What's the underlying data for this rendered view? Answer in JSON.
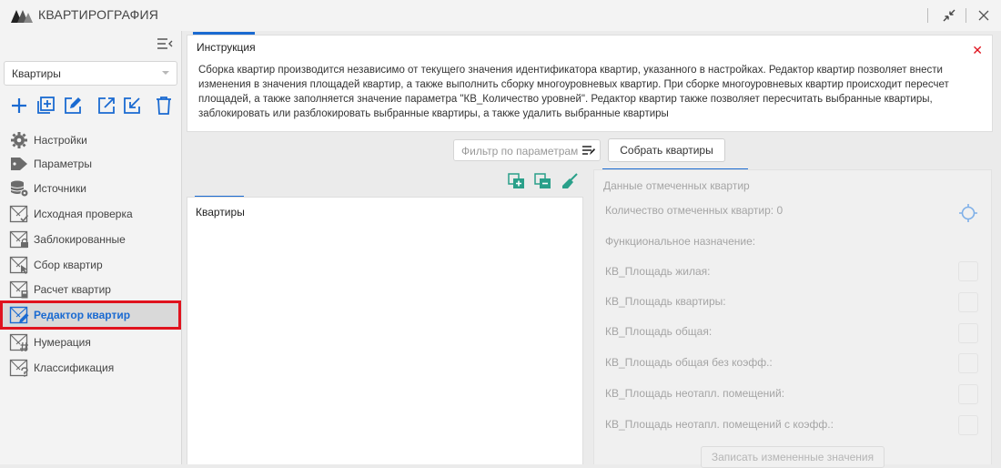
{
  "window": {
    "title": "КВАРТИРОГРАФИЯ",
    "restore_icon": "collapse-arrows-icon",
    "close_icon": "close-icon"
  },
  "sidebar": {
    "dropdown": {
      "value": "Квартиры"
    },
    "toolbar": [
      "add-icon",
      "add-box-icon",
      "edit-icon",
      "export-icon",
      "import-icon",
      "delete-icon"
    ],
    "items": [
      {
        "label": "Настройки",
        "icon": "gear-icon"
      },
      {
        "label": "Параметры",
        "icon": "tag-icon"
      },
      {
        "label": "Источники",
        "icon": "database-gear-icon"
      },
      {
        "label": "Исходная проверка",
        "icon": "check-plan-icon"
      },
      {
        "label": "Заблокированные",
        "icon": "lock-plan-icon"
      },
      {
        "label": "Сбор квартир",
        "icon": "cursor-plan-icon"
      },
      {
        "label": "Расчет квартир",
        "icon": "calc-plan-icon"
      },
      {
        "label": "Редактор квартир",
        "icon": "edit-plan-icon"
      },
      {
        "label": "Нумерация",
        "icon": "hash-plan-icon"
      },
      {
        "label": "Классификация",
        "icon": "question-plan-icon"
      }
    ],
    "active_index": 7
  },
  "instruction": {
    "title": "Инструкция",
    "text": "Сборка квартир производится независимо от текущего значения идентификатора квартир, указанного в настройках. Редактор квартир позволяет внести изменения в значения площадей квартир, а также выполнить сборку многоуровневых квартир. При сборке многоуровневых квартир происходит пересчет площадей, а также заполняется значение параметра \"КВ_Количество уровней\". Редактор квартир также позволяет пересчитать выбранные квартиры, заблокировать или разблокировать выбранные квартиры, а также удалить выбранные квартиры"
  },
  "filter": {
    "placeholder": "Фильтр по параметрам"
  },
  "build_button": "Собрать квартиры",
  "list": {
    "title": "Квартиры"
  },
  "data_panel": {
    "title": "Данные отмеченных квартир",
    "count_label": "Количество отмеченных квартир: 0",
    "purpose_label": "Функциональное назначение:",
    "fields": [
      "КВ_Площадь жилая:",
      "КВ_Площадь квартиры:",
      "КВ_Площадь общая:",
      "КВ_Площадь общая без коэфф.:",
      "КВ_Площадь неотапл. помещений:",
      "КВ_Площадь неотапл. помещений с коэфф.:"
    ],
    "save_button": "Записать измененные значения"
  },
  "colors": {
    "accent": "#1a6ad1",
    "active_outline": "#e0131e",
    "close": "#e0131e"
  }
}
